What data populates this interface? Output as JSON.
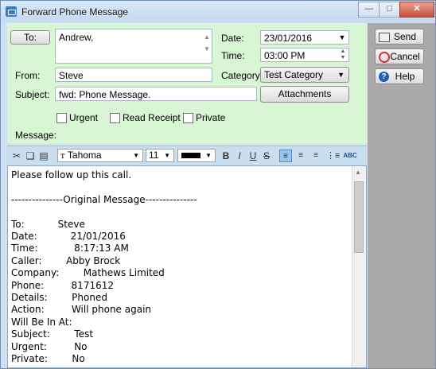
{
  "window": {
    "title": "Forward Phone Message"
  },
  "header": {
    "to_button": "To:",
    "to_value": "Andrew,",
    "date_label": "Date:",
    "date_value": "23/01/2016",
    "time_label": "Time:",
    "time_value": "03:00 PM",
    "from_label": "From:",
    "from_value": "Steve",
    "category_label": "Category:",
    "category_value": "Test Category",
    "subject_label": "Subject:",
    "subject_value": "fwd: Phone Message.",
    "attachments_button": "Attachments",
    "message_label": "Message:"
  },
  "options": {
    "urgent": "Urgent",
    "read_receipt": "Read Receipt",
    "private": "Private"
  },
  "actions": {
    "send": "Send",
    "cancel": "Cancel",
    "help": "Help"
  },
  "toolbar": {
    "font_name": "Tahoma",
    "font_size": "11",
    "bold": "B",
    "italic": "I",
    "underline": "U",
    "strike": "S",
    "spellcheck": "ABC"
  },
  "editor": {
    "lines": [
      "Please follow up this call.",
      "",
      "---------------Original Message---------------",
      "",
      "To:           Steve",
      "Date:           21/01/2016",
      "Time:            8:17:13 AM",
      "Caller:        Abby Brock",
      "Company:        Mathews Limited",
      "Phone:         8171612",
      "Details:        Phoned",
      "Action:         Will phone again",
      "Will Be In At:",
      "Subject:        Test",
      "Urgent:         No",
      "Private:        No"
    ]
  }
}
